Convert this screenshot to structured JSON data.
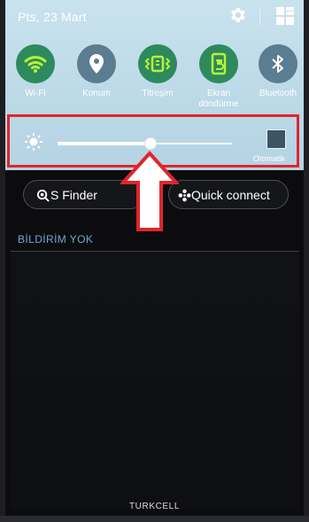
{
  "status": {
    "date": "Pts, 23 Mart"
  },
  "quick_toggles": [
    {
      "label": "Wi-Fi",
      "icon": "wifi-icon",
      "state": "on"
    },
    {
      "label": "Konum",
      "icon": "location-icon",
      "state": "off"
    },
    {
      "label": "Titreşim",
      "icon": "vibrate-icon",
      "state": "on"
    },
    {
      "label": "Ekran döndürme",
      "label_line1": "Ekran",
      "label_line2": "döndürme",
      "icon": "screen-rotation-icon",
      "state": "on"
    },
    {
      "label": "Bluetooth",
      "icon": "bluetooth-icon",
      "state": "off"
    }
  ],
  "brightness": {
    "level": 0.53,
    "auto_label": "Otomatik",
    "auto_checked": false
  },
  "buttons": {
    "s_finder": "S Finder",
    "quick_connect": "Quick connect"
  },
  "notifications": {
    "empty_label": "BİLDİRİM YOK"
  },
  "carrier": "TURKCELL",
  "colors": {
    "panel": "#bcd9e7",
    "toggle_on": "#2d8a5c",
    "toggle_off": "#5b7d92",
    "active_glyph": "#b8f23a",
    "highlight": "#e0252b",
    "no_notif_text": "#6aa9c9"
  }
}
